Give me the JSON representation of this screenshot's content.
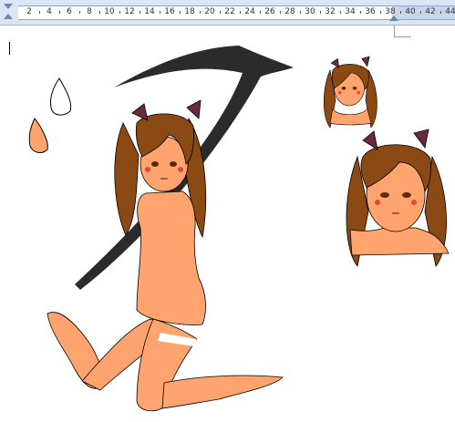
{
  "ruler": {
    "labels": [
      "2",
      "4",
      "6",
      "8",
      "10",
      "12",
      "14",
      "16",
      "18",
      "20",
      "22",
      "24",
      "26",
      "28",
      "30",
      "32",
      "34",
      "36",
      "38",
      "40",
      "42",
      "44"
    ]
  },
  "colors": {
    "ruler_bg": "#dbe6f5",
    "skin": "#ffa46e",
    "hair": "#8b4a14",
    "bow": "#6b2a3a",
    "scythe": "#2b2b2b",
    "blush": "#e04a3a"
  }
}
